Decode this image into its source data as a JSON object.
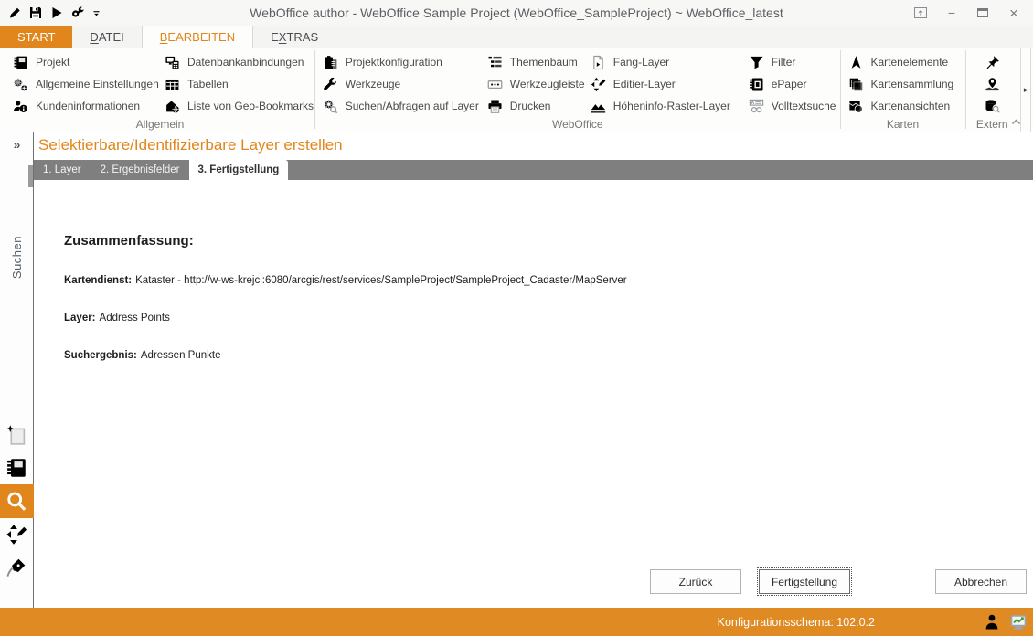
{
  "window": {
    "title": "WebOffice author - WebOffice Sample Project (WebOffice_SampleProject) ~ WebOffice_latest",
    "minimize_glyph": "−",
    "close_glyph": "×",
    "popup_glyph": "↑"
  },
  "ribbon": {
    "tabs": [
      {
        "label": "START",
        "underline_index": -1
      },
      {
        "label": "DATEI",
        "underline_index": 0
      },
      {
        "label": "BEARBEITEN",
        "underline_index": 0
      },
      {
        "label": "EXTRAS",
        "underline_index": 1
      }
    ],
    "groups": [
      {
        "label": "Allgemein",
        "items": [
          "Projekt",
          "Allgemeine Einstellungen",
          "Kundeninformationen",
          "Datenbankanbindungen",
          "Tabellen",
          "Liste von Geo-Bookmarks"
        ]
      },
      {
        "label": "WebOffice",
        "items": [
          "Projektkonfiguration",
          "Werkzeuge",
          "Suchen/Abfragen auf Layer",
          "Themenbaum",
          "Werkzeugleiste",
          "Drucken",
          "Fang-Layer",
          "Editier-Layer",
          "Höheninfo-Raster-Layer",
          "Filter",
          "ePaper",
          "Volltextsuche"
        ]
      },
      {
        "label": "Karten",
        "items": [
          "Kartenelemente",
          "Kartensammlung",
          "Kartenansichten"
        ]
      },
      {
        "label": "Extern",
        "items": []
      }
    ],
    "expand_glyph": "▸"
  },
  "sidebar": {
    "collapse_glyph": "»",
    "panel_label": "Suchen"
  },
  "wizard": {
    "title": "Selektierbare/Identifizierbare Layer erstellen",
    "steps": [
      "1. Layer",
      "2. Ergebnisfelder",
      "3. Fertigstellung"
    ],
    "active_step": "3. Fertigstellung",
    "summary_heading": "Zusammenfassung:",
    "fields": [
      {
        "label": "Kartendienst:",
        "value": "Kataster - http://w-ws-krejci:6080/arcgis/rest/services/SampleProject/SampleProject_Cadaster/MapServer"
      },
      {
        "label": "Layer:",
        "value": "Address Points"
      },
      {
        "label": "Suchergebnis:",
        "value": "Adressen Punkte"
      }
    ],
    "buttons": {
      "back": "Zurück",
      "finish": "Fertigstellung",
      "cancel": "Abbrechen"
    }
  },
  "status_bar": {
    "label": "Konfigurationsschema:",
    "value": "102.0.2"
  },
  "colors": {
    "accent_orange": "#e0861c",
    "status_orange": "#e08a24",
    "wizard_tabstrip_gray": "#7f7f7f"
  }
}
